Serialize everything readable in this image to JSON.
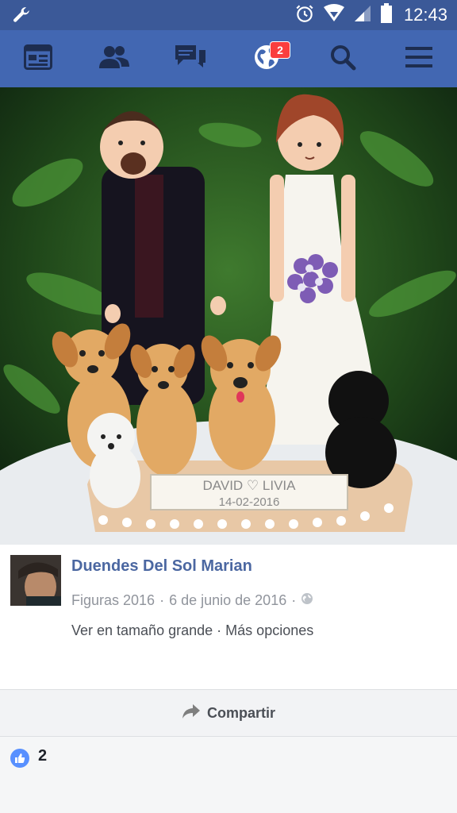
{
  "status_bar": {
    "time": "12:43",
    "icons": [
      "wrench-icon",
      "alarm-icon",
      "wifi-icon",
      "signal-icon",
      "battery-icon"
    ]
  },
  "nav": {
    "items": [
      {
        "name": "news-feed",
        "icon": "news-feed-icon"
      },
      {
        "name": "friends",
        "icon": "friends-icon"
      },
      {
        "name": "messages",
        "icon": "messages-icon"
      },
      {
        "name": "notifications",
        "icon": "globe-icon",
        "badge": "2"
      },
      {
        "name": "search",
        "icon": "search-icon"
      },
      {
        "name": "menu",
        "icon": "hamburger-icon"
      }
    ]
  },
  "photo": {
    "plaque_text": "DAVID ♡ LIVIA",
    "plaque_date": "14-02-2016"
  },
  "post": {
    "author": "Duendes Del Sol Marian",
    "album": "Figuras 2016",
    "date": "6 de junio de 2016",
    "separator": "·",
    "view_large": "Ver en tamaño grande",
    "more_options": "Más opciones"
  },
  "share": {
    "label": "Compartir"
  },
  "reactions": {
    "like_count": "2"
  },
  "colors": {
    "status_bar": "#3b5998",
    "nav_bar": "#4267b2",
    "author_link": "#4b67a1",
    "badge": "#fa3e3e",
    "like_blue": "#5890ff"
  }
}
